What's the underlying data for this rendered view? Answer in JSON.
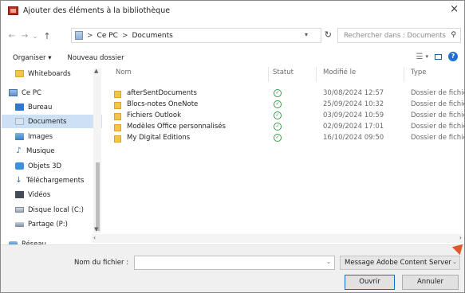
{
  "window": {
    "title": "Ajouter des éléments à la bibliothèque",
    "close_glyph": "×"
  },
  "nav": {
    "back_glyph": "←",
    "forward_glyph": "→",
    "recent_glyph": "⌄",
    "up_glyph": "↑",
    "breadcrumb": [
      "Ce PC",
      "Documents"
    ],
    "breadcrumb_sep": ">",
    "refresh_glyph": "↻",
    "search_placeholder": "Rechercher dans : Documents"
  },
  "toolbar": {
    "organize_label": "Organiser ▾",
    "new_folder_label": "Nouveau dossier",
    "help_glyph": "?"
  },
  "sidebar": {
    "items": [
      {
        "label": "Whiteboards",
        "icon": "folder-icon"
      },
      {
        "label": "Ce PC",
        "icon": "pc-icon"
      },
      {
        "label": "Bureau",
        "icon": "desktop-icon"
      },
      {
        "label": "Documents",
        "icon": "documents-icon",
        "selected": true
      },
      {
        "label": "Images",
        "icon": "images-icon"
      },
      {
        "label": "Musique",
        "icon": "music-icon"
      },
      {
        "label": "Objets 3D",
        "icon": "objects-3d-icon"
      },
      {
        "label": "Téléchargements",
        "icon": "downloads-icon"
      },
      {
        "label": "Vidéos",
        "icon": "videos-icon"
      },
      {
        "label": "Disque local (C:)",
        "icon": "disk-icon"
      },
      {
        "label": "Partage (P:)",
        "icon": "network-drive-icon"
      },
      {
        "label": "Réseau",
        "icon": "network-icon"
      }
    ]
  },
  "filelist": {
    "columns": [
      "Nom",
      "Statut",
      "Modifié le",
      "Type"
    ],
    "rows": [
      {
        "name": "afterSentDocuments",
        "date": "30/08/2024 12:57",
        "type": "Dossier de fichiers"
      },
      {
        "name": "Blocs-notes OneNote",
        "date": "25/09/2024 10:32",
        "type": "Dossier de fichiers"
      },
      {
        "name": "Fichiers Outlook",
        "date": "03/09/2024 10:59",
        "type": "Dossier de fichiers"
      },
      {
        "name": "Modèles Office personnalisés",
        "date": "02/09/2024 17:01",
        "type": "Dossier de fichiers"
      },
      {
        "name": "My Digital Editions",
        "date": "16/10/2024 09:50",
        "type": "Dossier de fichiers"
      }
    ],
    "status_glyph": "✓"
  },
  "bottom": {
    "filename_label": "Nom du fichier :",
    "filename_value": "",
    "filter_value": "Message Adobe Content Server",
    "open_label": "Ouvrir",
    "cancel_label": "Annuler"
  }
}
